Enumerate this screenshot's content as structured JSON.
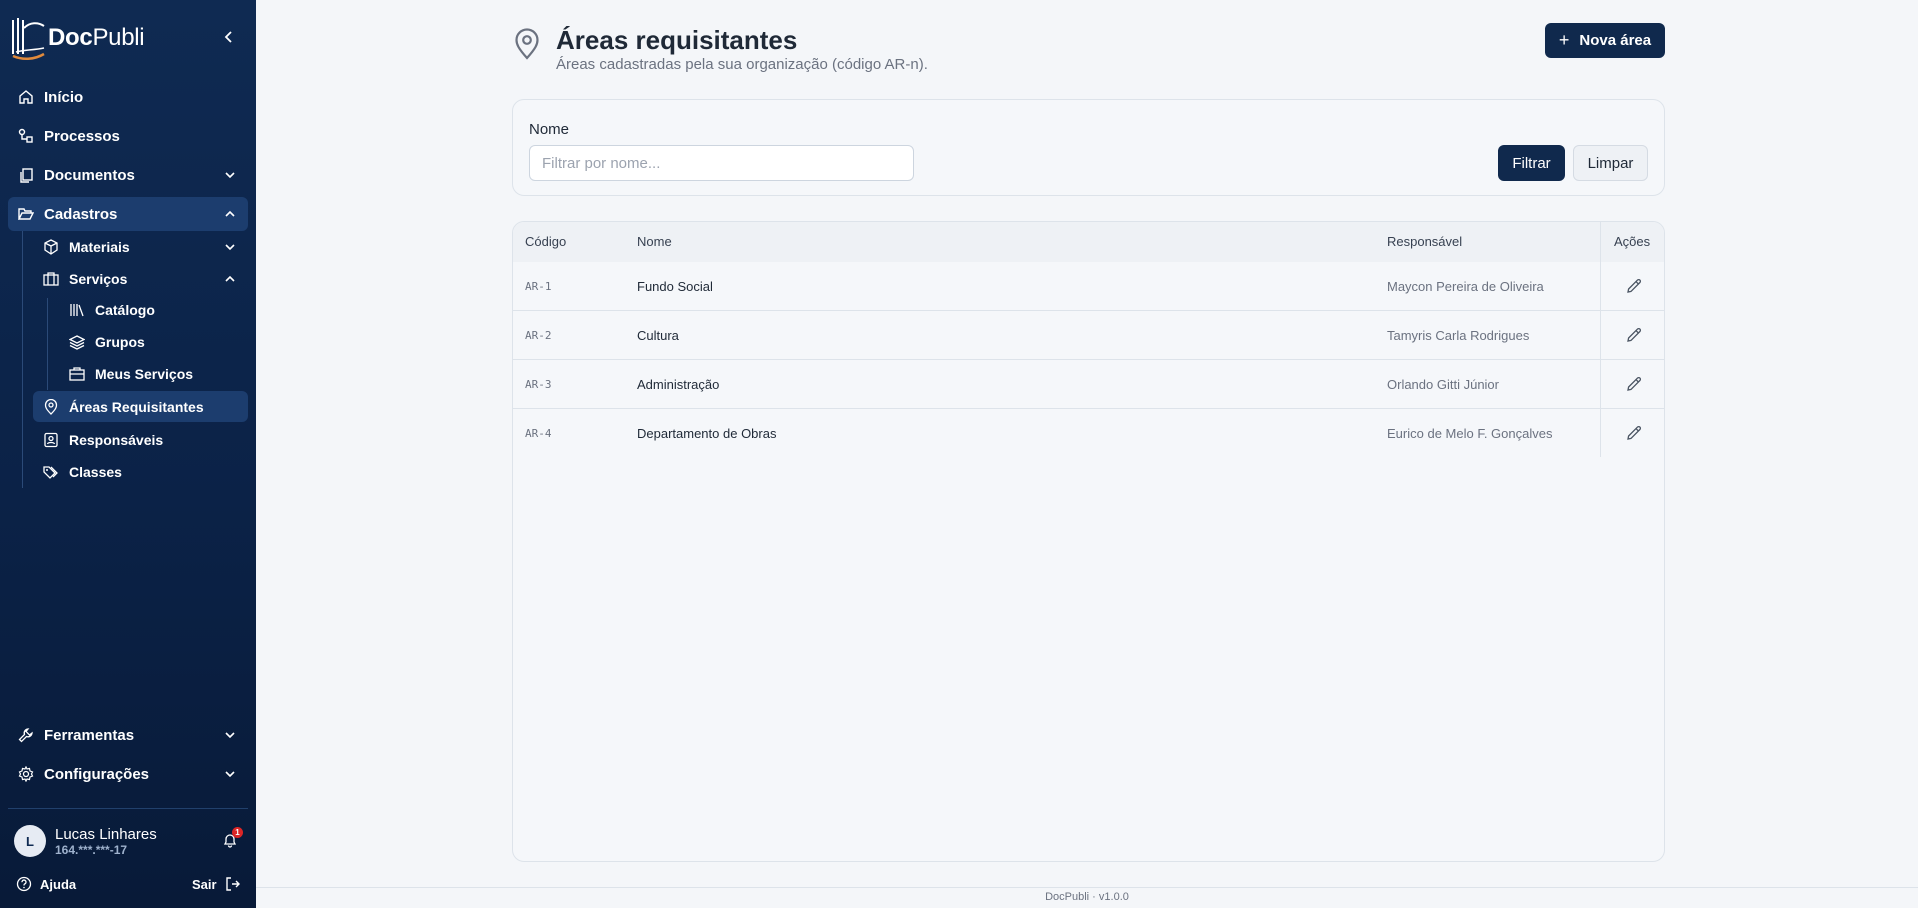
{
  "brand": {
    "name_bold": "Doc",
    "name_regular": "Publi"
  },
  "sidebar": {
    "items": [
      {
        "label": "Início",
        "icon": "home-icon"
      },
      {
        "label": "Processos",
        "icon": "workflow-icon"
      },
      {
        "label": "Documentos",
        "icon": "documents-icon"
      },
      {
        "label": "Cadastros",
        "icon": "folder-open-icon"
      },
      {
        "label": "Materiais",
        "icon": "box-icon"
      },
      {
        "label": "Serviços",
        "icon": "briefcase-icon"
      },
      {
        "label": "Catálogo",
        "icon": "library-icon"
      },
      {
        "label": "Grupos",
        "icon": "layers-icon"
      },
      {
        "label": "Meus Serviços",
        "icon": "briefcase-check-icon"
      },
      {
        "label": "Áreas Requisitantes",
        "icon": "map-pin-icon"
      },
      {
        "label": "Responsáveis",
        "icon": "contact-icon"
      },
      {
        "label": "Classes",
        "icon": "tags-icon"
      },
      {
        "label": "Ferramentas",
        "icon": "wrench-icon"
      },
      {
        "label": "Configurações",
        "icon": "gear-icon"
      }
    ],
    "user": {
      "initial": "L",
      "name": "Lucas Linhares",
      "id": "164.***.***-17",
      "notifications": "1"
    },
    "help_label": "Ajuda",
    "logout_label": "Sair"
  },
  "header": {
    "title": "Áreas requisitantes",
    "subtitle": "Áreas cadastradas pela sua organização (código AR-n).",
    "new_button": "Nova área"
  },
  "filter": {
    "label": "Nome",
    "placeholder": "Filtrar por nome...",
    "value": "",
    "filter_button": "Filtrar",
    "clear_button": "Limpar"
  },
  "table": {
    "columns": [
      "Código",
      "Nome",
      "Responsável",
      "Ações"
    ],
    "rows": [
      {
        "code": "AR-1",
        "name": "Fundo Social",
        "responsible": "Maycon Pereira de Oliveira"
      },
      {
        "code": "AR-2",
        "name": "Cultura",
        "responsible": "Tamyris Carla Rodrigues"
      },
      {
        "code": "AR-3",
        "name": "Administração",
        "responsible": "Orlando Gitti Júnior"
      },
      {
        "code": "AR-4",
        "name": "Departamento de Obras",
        "responsible": "Eurico de Melo F. Gonçalves"
      }
    ]
  },
  "footer": "DocPubli · v1.0.0",
  "colors": {
    "sidebar_bg": "#0f2a52",
    "primary": "#10294d",
    "active_item": "#1c3d6e",
    "badge": "#dc2626",
    "logo_accent": "#e08a3c"
  }
}
